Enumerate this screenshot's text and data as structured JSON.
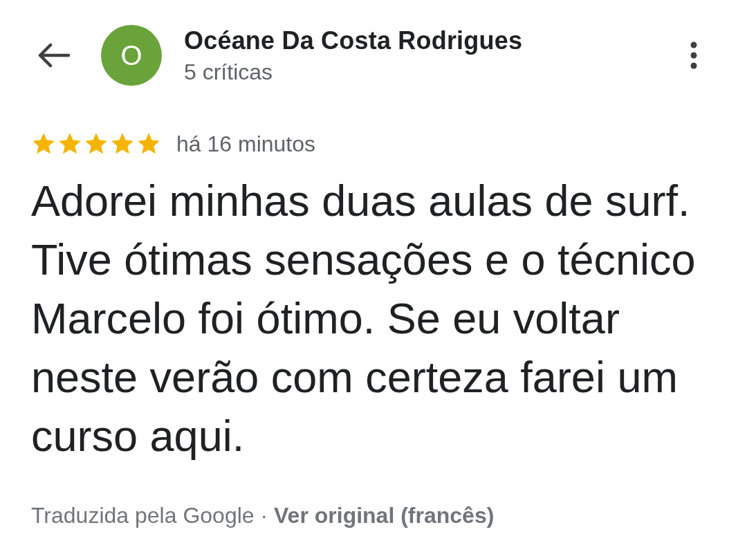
{
  "header": {
    "avatar_letter": "O",
    "name": "Océane Da Costa Rodrigues",
    "subtitle": "5 críticas"
  },
  "review": {
    "stars": 5,
    "time": "há 16 minutos",
    "text": "Adorei minhas duas aulas de surf. Tive ótimas sensações e o técnico Marcelo foi ótimo. Se eu voltar neste verão com certeza farei um curso aqui."
  },
  "footer": {
    "note": "Traduzida pela Google · ",
    "link": "Ver original (francês)"
  }
}
